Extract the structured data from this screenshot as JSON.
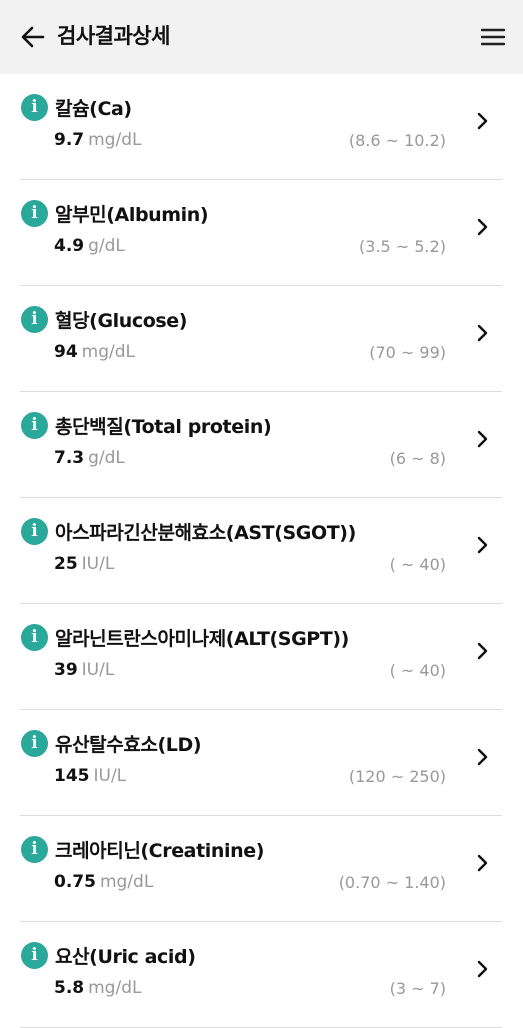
{
  "header": {
    "title": "검사결과상세",
    "back_icon": "arrow-left-icon",
    "menu_icon": "hamburger-menu-icon"
  },
  "accent_color": "#2aa89a",
  "results": [
    {
      "name": "칼슘(Ca)",
      "value": "9.7",
      "unit": "mg/dL",
      "range": "(8.6 ~ 10.2)"
    },
    {
      "name": "알부민(Albumin)",
      "value": "4.9",
      "unit": "g/dL",
      "range": "(3.5 ~ 5.2)"
    },
    {
      "name": "혈당(Glucose)",
      "value": "94",
      "unit": "mg/dL",
      "range": "(70 ~ 99)"
    },
    {
      "name": "총단백질(Total protein)",
      "value": "7.3",
      "unit": "g/dL",
      "range": "(6 ~ 8)"
    },
    {
      "name": "아스파라긴산분해효소(AST(SGOT))",
      "value": "25",
      "unit": "IU/L",
      "range": "( ~ 40)"
    },
    {
      "name": "알라닌트란스아미나제(ALT(SGPT))",
      "value": "39",
      "unit": "IU/L",
      "range": "( ~ 40)"
    },
    {
      "name": "유산탈수효소(LD)",
      "value": "145",
      "unit": "IU/L",
      "range": "(120 ~ 250)"
    },
    {
      "name": "크레아티닌(Creatinine)",
      "value": "0.75",
      "unit": "mg/dL",
      "range": "(0.70 ~ 1.40)"
    },
    {
      "name": "요산(Uric acid)",
      "value": "5.8",
      "unit": "mg/dL",
      "range": "(3 ~ 7)"
    }
  ]
}
